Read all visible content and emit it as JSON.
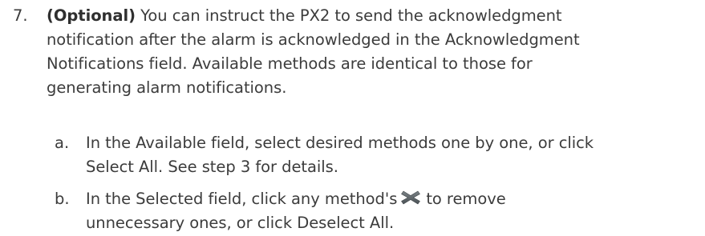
{
  "step": {
    "number": "7.",
    "optional_label": "(Optional)",
    "line1_rest": " You can instruct the PX2 to send the acknowledgment",
    "line2": "notification after the alarm is acknowledged in the Acknowledgment",
    "line3": "Notifications field. Available methods are identical to those for",
    "line4": "generating alarm notifications."
  },
  "substeps": [
    {
      "letter": "a.",
      "line1": "In the Available field, select desired methods one by one, or click",
      "line2": "Select All. See step 3 for details."
    },
    {
      "letter": "b.",
      "line1_before_icon": "In the Selected field, click any method's",
      "icon": "remove-x-icon",
      "line1_after_icon": "to remove",
      "line2": "unnecessary ones, or click Deselect All."
    }
  ],
  "colors": {
    "text": "#3c3c3c",
    "icon": "#5a6266"
  }
}
